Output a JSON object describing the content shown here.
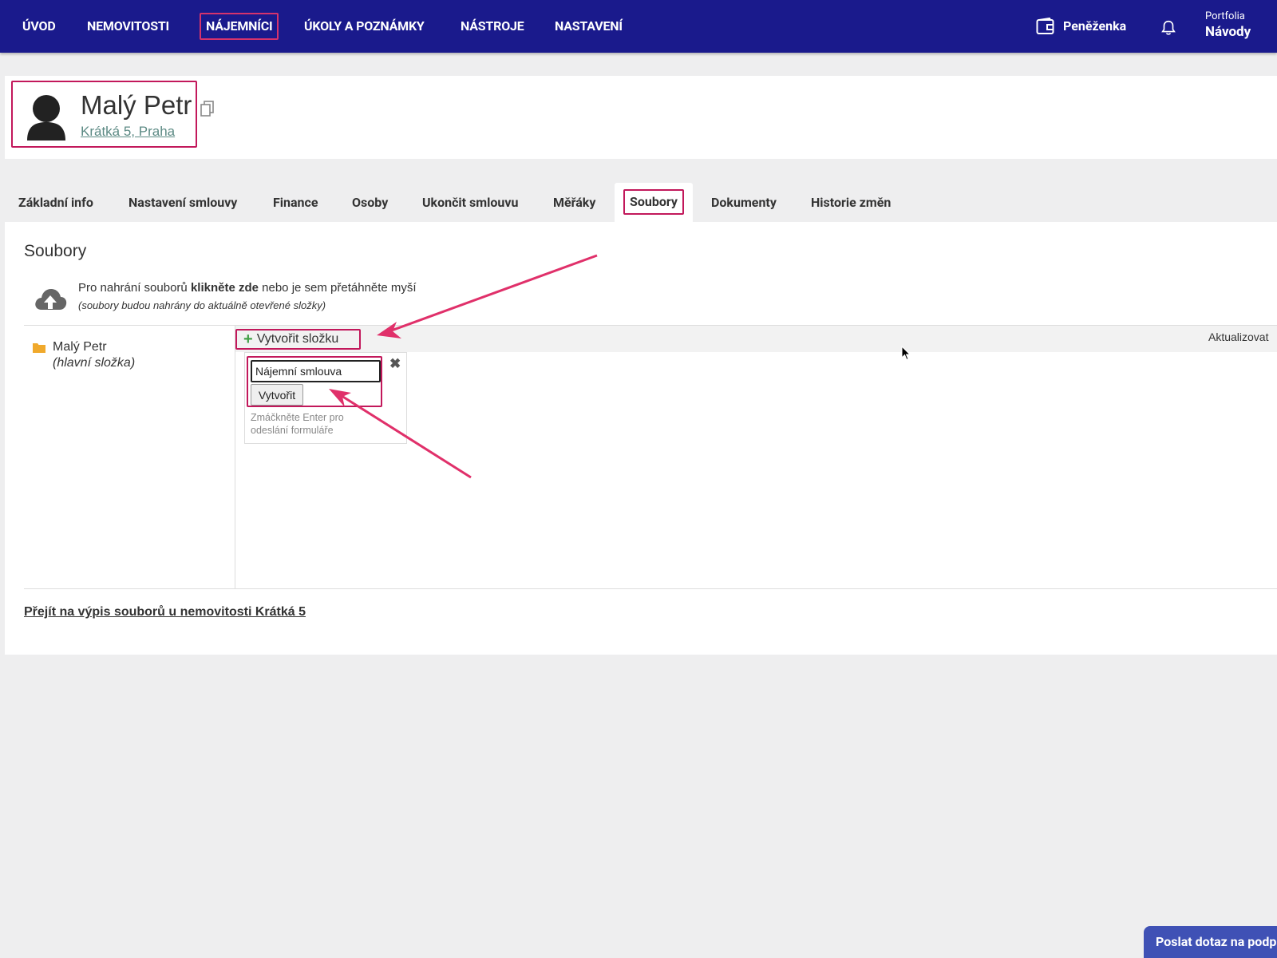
{
  "nav": {
    "items": [
      {
        "label": "ÚVOD"
      },
      {
        "label": "NEMOVITOSTI"
      },
      {
        "label": "NÁJEMNÍCI"
      },
      {
        "label": "ÚKOLY A POZNÁMKY"
      },
      {
        "label": "NÁSTROJE"
      },
      {
        "label": "NASTAVENÍ"
      }
    ],
    "wallet_label": "Peněženka",
    "portfolio_small": "Portfolia",
    "portfolio_name": "Návody"
  },
  "tenant": {
    "name": "Malý Petr",
    "address": "Krátká 5, Praha"
  },
  "tabs": [
    {
      "label": "Základní info"
    },
    {
      "label": "Nastavení smlouvy"
    },
    {
      "label": "Finance"
    },
    {
      "label": "Osoby"
    },
    {
      "label": "Ukončit smlouvu"
    },
    {
      "label": "Měřáky"
    },
    {
      "label": "Soubory",
      "active": true
    },
    {
      "label": "Dokumenty"
    },
    {
      "label": "Historie změn"
    }
  ],
  "files": {
    "title": "Soubory",
    "upload_pre": "Pro nahrání souborů ",
    "upload_bold": "klikněte zde",
    "upload_post": " nebo je sem přetáhněte myší",
    "upload_note": "(soubory budou nahrány do aktuálně otevřené složky)",
    "folder_name": "Malý Petr",
    "folder_sub": "(hlavní složka)",
    "create_folder_label": "Vytvořit složku",
    "refresh_label": "Aktualizovat",
    "new_folder_value": "Nájemní smlouva",
    "create_button_label": "Vytvořit",
    "enter_hint": "Zmáčkněte Enter pro odeslání formuláře",
    "goto_link": "Přejít na výpis souborů u nemovitosti Krátká 5"
  },
  "support_button": "Poslat dotaz na podp",
  "colors": {
    "nav_bg": "#1a1a8c",
    "highlight": "#c2185b",
    "arrow": "#e0306a",
    "support_bg": "#3f51b5"
  }
}
